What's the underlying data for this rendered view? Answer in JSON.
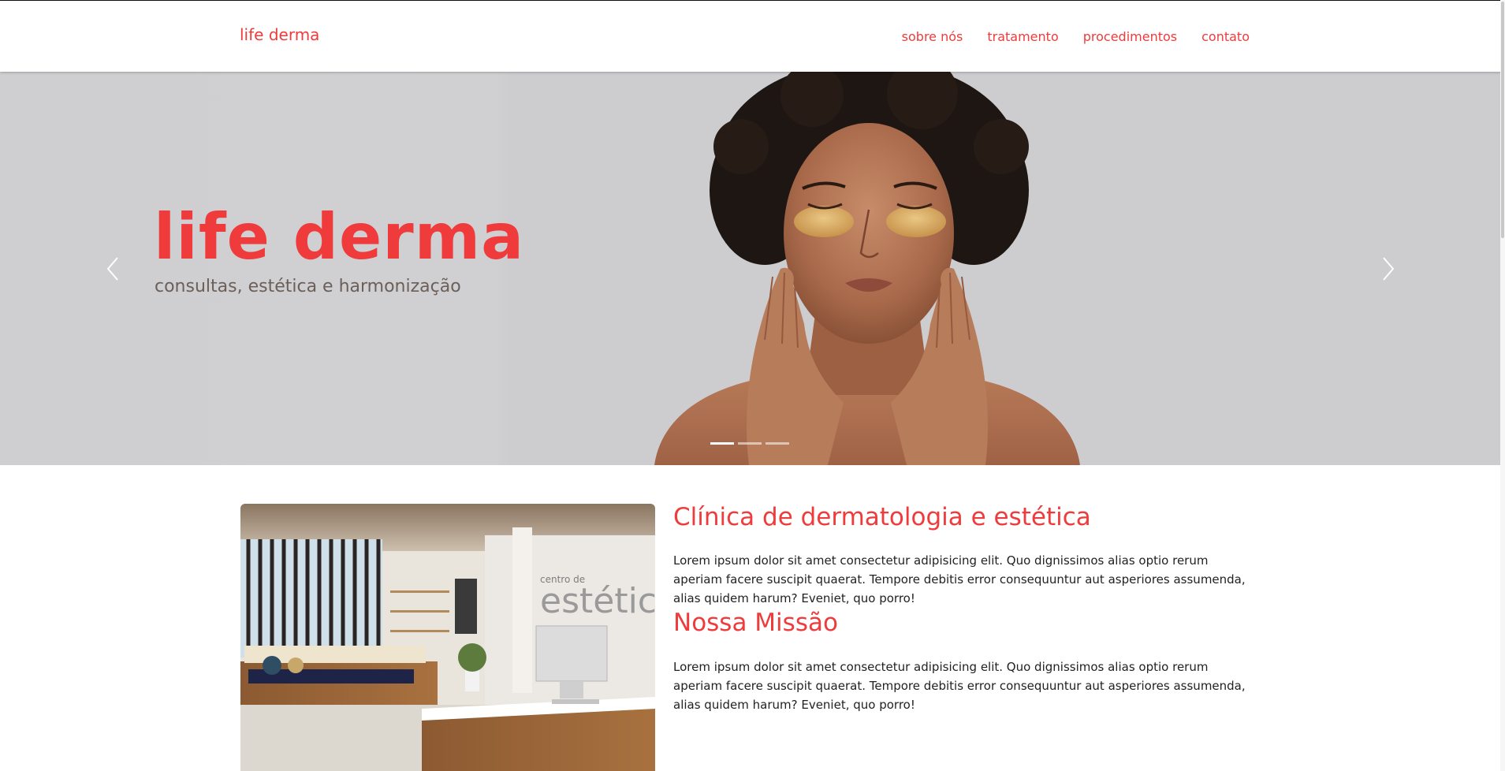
{
  "brand": "life derma",
  "nav": {
    "items": [
      "sobre nós",
      "tratamento",
      "procedimentos",
      "contato"
    ]
  },
  "hero": {
    "title": "life derma",
    "subtitle": "consultas, estética e harmonização",
    "slide_count": 3,
    "active_slide": 1,
    "image_alt": "woman-with-under-eye-patches"
  },
  "clinic": {
    "image_alt": "clinic-reception",
    "wall_sign_small": "centro de",
    "wall_sign_large": "estétic"
  },
  "sections": [
    {
      "heading": "Clínica de dermatologia e estética",
      "text": "Lorem ipsum dolor sit amet consectetur adipisicing elit. Quo dignissimos alias optio rerum aperiam facere suscipit quaerat. Tempore debitis error consequuntur aut asperiores assumenda, alias quidem harum? Eveniet, quo porro!"
    },
    {
      "heading": "Nossa Missão",
      "text": "Lorem ipsum dolor sit amet consectetur adipisicing elit. Quo dignissimos alias optio rerum aperiam facere suscipit quaerat. Tempore debitis error consequuntur aut asperiores assumenda, alias quidem harum? Eveniet, quo porro!"
    }
  ],
  "colors": {
    "accent": "#ef3b3b",
    "hero_bg": "#cfcfd1",
    "text": "#222222"
  },
  "icons": {
    "prev": "chevron-left-icon",
    "next": "chevron-right-icon"
  }
}
